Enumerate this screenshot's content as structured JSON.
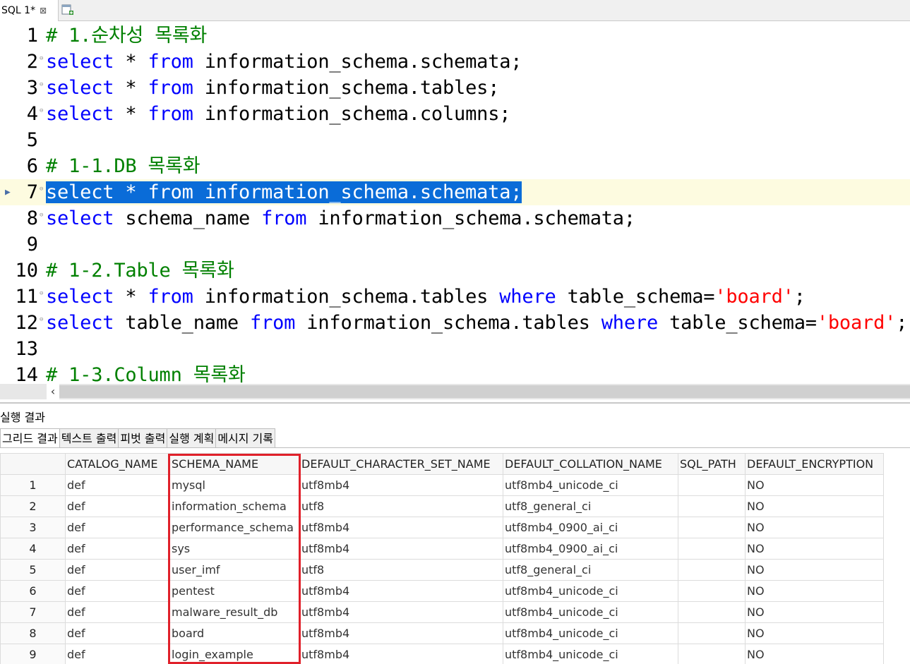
{
  "tab": {
    "label": "SQL 1*",
    "close": "⊠"
  },
  "editor": {
    "current_line": 7,
    "lines": [
      {
        "num": "1",
        "parts": [
          {
            "t": "# 1.순차성 목록화",
            "c": "cm"
          }
        ]
      },
      {
        "num": "2",
        "parts": [
          {
            "t": "select",
            "c": "kw"
          },
          {
            "t": " * "
          },
          {
            "t": "from",
            "c": "kw"
          },
          {
            "t": " information_schema.schemata;"
          }
        ]
      },
      {
        "num": "3",
        "parts": [
          {
            "t": "select",
            "c": "kw"
          },
          {
            "t": " * "
          },
          {
            "t": "from",
            "c": "kw"
          },
          {
            "t": " information_schema.tables;"
          }
        ]
      },
      {
        "num": "4",
        "parts": [
          {
            "t": "select",
            "c": "kw"
          },
          {
            "t": " * "
          },
          {
            "t": "from",
            "c": "kw"
          },
          {
            "t": " information_schema.columns;"
          }
        ]
      },
      {
        "num": "5",
        "parts": []
      },
      {
        "num": "6",
        "parts": [
          {
            "t": "# 1-1.DB 목록화",
            "c": "cm"
          }
        ]
      },
      {
        "num": "7",
        "parts": [
          {
            "t": "select * from information_schema.schemata;",
            "c": "sel"
          }
        ]
      },
      {
        "num": "8",
        "parts": [
          {
            "t": "select",
            "c": "kw"
          },
          {
            "t": " schema_name "
          },
          {
            "t": "from",
            "c": "kw"
          },
          {
            "t": " information_schema.schemata;"
          }
        ]
      },
      {
        "num": "9",
        "parts": []
      },
      {
        "num": "10",
        "parts": [
          {
            "t": "# 1-2.Table 목록화",
            "c": "cm"
          }
        ]
      },
      {
        "num": "11",
        "parts": [
          {
            "t": "select",
            "c": "kw"
          },
          {
            "t": " * "
          },
          {
            "t": "from",
            "c": "kw"
          },
          {
            "t": " information_schema.tables "
          },
          {
            "t": "where",
            "c": "kw"
          },
          {
            "t": " table_schema="
          },
          {
            "t": "'board'",
            "c": "st"
          },
          {
            "t": ";"
          }
        ]
      },
      {
        "num": "12",
        "parts": [
          {
            "t": "select",
            "c": "kw"
          },
          {
            "t": " table_name "
          },
          {
            "t": "from",
            "c": "kw"
          },
          {
            "t": " information_schema.tables "
          },
          {
            "t": "where",
            "c": "kw"
          },
          {
            "t": " table_schema="
          },
          {
            "t": "'board'",
            "c": "st"
          },
          {
            "t": ";"
          }
        ]
      },
      {
        "num": "13",
        "parts": []
      },
      {
        "num": "14",
        "parts": [
          {
            "t": "# 1-3.Column 목록화",
            "c": "cm"
          }
        ]
      }
    ]
  },
  "results": {
    "title": "실행 결과",
    "tabs": [
      "그리드 결과",
      "텍스트 출력",
      "피벗 출력",
      "실행 계획",
      "메시지 기록"
    ],
    "columns": [
      "CATALOG_NAME",
      "SCHEMA_NAME",
      "DEFAULT_CHARACTER_SET_NAME",
      "DEFAULT_COLLATION_NAME",
      "SQL_PATH",
      "DEFAULT_ENCRYPTION"
    ],
    "rows": [
      [
        "1",
        "def",
        "mysql",
        "utf8mb4",
        "utf8mb4_unicode_ci",
        "",
        "NO"
      ],
      [
        "2",
        "def",
        "information_schema",
        "utf8",
        "utf8_general_ci",
        "",
        "NO"
      ],
      [
        "3",
        "def",
        "performance_schema",
        "utf8mb4",
        "utf8mb4_0900_ai_ci",
        "",
        "NO"
      ],
      [
        "4",
        "def",
        "sys",
        "utf8mb4",
        "utf8mb4_0900_ai_ci",
        "",
        "NO"
      ],
      [
        "5",
        "def",
        "user_imf",
        "utf8",
        "utf8_general_ci",
        "",
        "NO"
      ],
      [
        "6",
        "def",
        "pentest",
        "utf8mb4",
        "utf8mb4_unicode_ci",
        "",
        "NO"
      ],
      [
        "7",
        "def",
        "malware_result_db",
        "utf8mb4",
        "utf8mb4_unicode_ci",
        "",
        "NO"
      ],
      [
        "8",
        "def",
        "board",
        "utf8mb4",
        "utf8mb4_unicode_ci",
        "",
        "NO"
      ],
      [
        "9",
        "def",
        "login_example",
        "utf8mb4",
        "utf8mb4_unicode_ci",
        "",
        "NO"
      ]
    ]
  },
  "colors": {
    "keyword": "#0000ff",
    "comment": "#008000",
    "string": "#ff0000",
    "selection": "#0a6cd8",
    "highlight_box": "#e0202a"
  }
}
